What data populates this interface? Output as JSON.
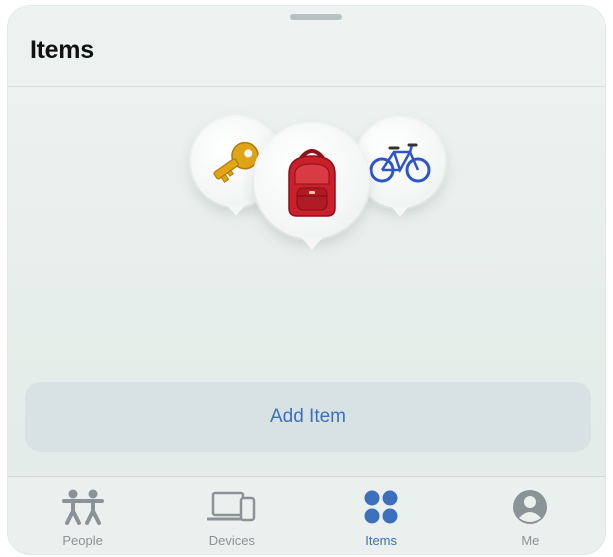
{
  "header": {
    "title": "Items"
  },
  "illustration": {
    "icons": [
      "key-icon",
      "backpack-icon",
      "bicycle-icon"
    ]
  },
  "actions": {
    "add_item_label": "Add Item"
  },
  "tabbar": {
    "tabs": [
      {
        "label": "People",
        "icon": "people-icon",
        "active": false
      },
      {
        "label": "Devices",
        "icon": "devices-icon",
        "active": false
      },
      {
        "label": "Items",
        "icon": "items-icon",
        "active": true
      },
      {
        "label": "Me",
        "icon": "me-icon",
        "active": false
      }
    ]
  },
  "colors": {
    "accent": "#3d6fbd",
    "inactive_tab": "#8a9396",
    "key_gold": "#e0a419",
    "backpack_red": "#c9202c",
    "bike_blue": "#2f55c7"
  }
}
